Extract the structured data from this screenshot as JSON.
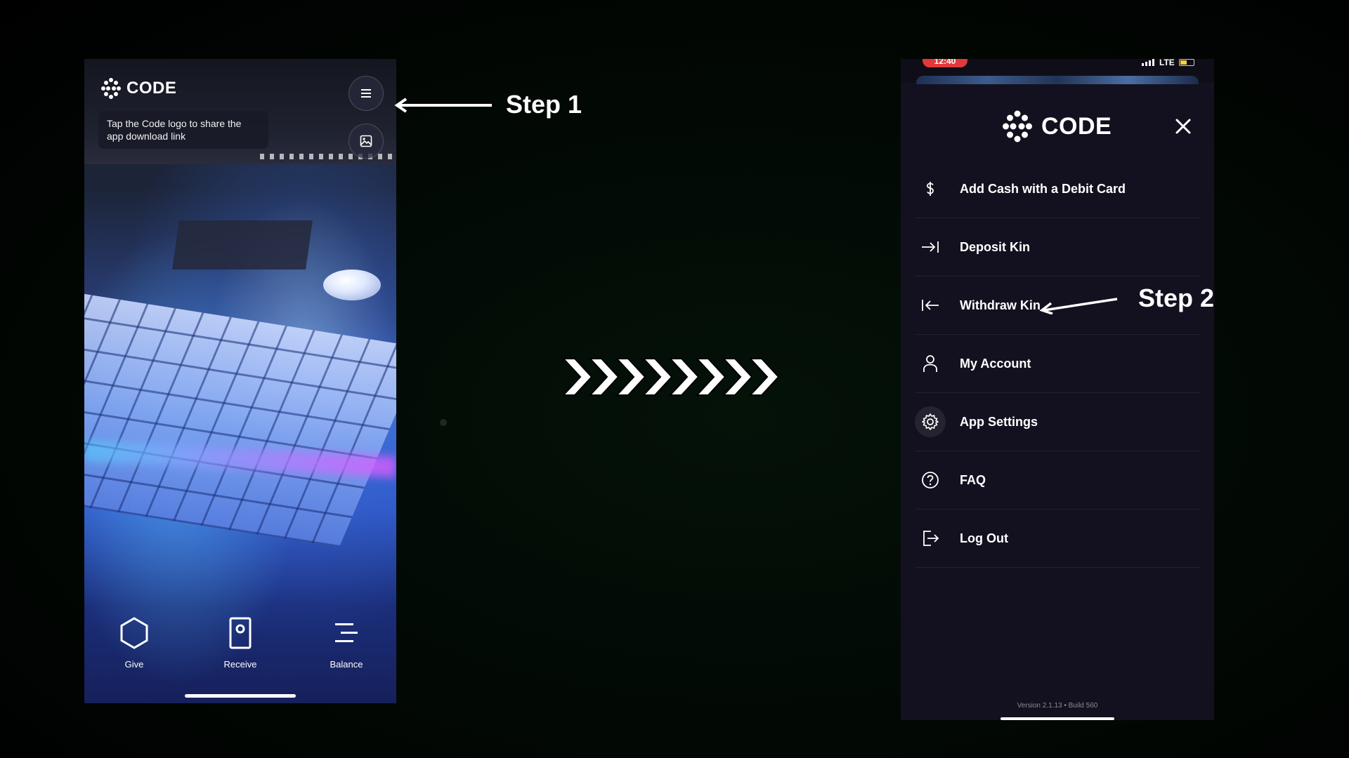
{
  "left_phone": {
    "logo_text": "CODE",
    "tooltip": "Tap the Code logo to share the app download link",
    "menu_button_icon": "hamburger-menu-icon",
    "photo_button_icon": "photo-icon",
    "nav": [
      {
        "label": "Give",
        "icon": "hexagon-icon"
      },
      {
        "label": "Receive",
        "icon": "receive-code-icon"
      },
      {
        "label": "Balance",
        "icon": "balance-lines-icon"
      }
    ]
  },
  "annotations": {
    "step1": "Step 1",
    "step2": "Step 2",
    "chevron_count": 8
  },
  "right_phone": {
    "status": {
      "time": "12:40",
      "network": "LTE"
    },
    "logo_text": "CODE",
    "menu": [
      {
        "label": "Add Cash with a Debit Card",
        "icon": "dollar-icon"
      },
      {
        "label": "Deposit Kin",
        "icon": "arrow-right-bar-icon"
      },
      {
        "label": "Withdraw Kin",
        "icon": "arrow-left-bar-icon"
      },
      {
        "label": "My Account",
        "icon": "person-icon"
      },
      {
        "label": "App Settings",
        "icon": "gear-icon"
      },
      {
        "label": "FAQ",
        "icon": "question-circle-icon"
      },
      {
        "label": "Log Out",
        "icon": "logout-icon"
      }
    ],
    "version": "Version 2.1.13 • Build 560"
  }
}
